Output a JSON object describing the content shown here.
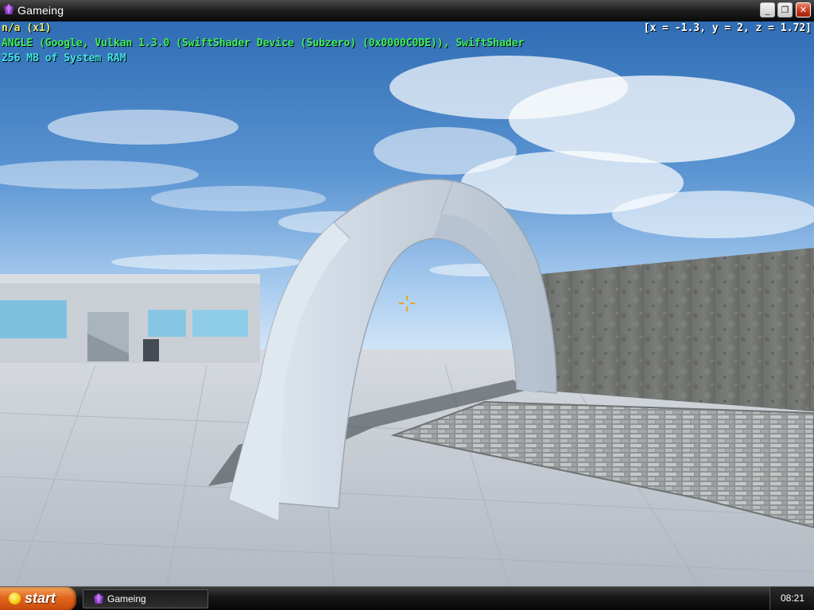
{
  "window": {
    "title": "Gameing",
    "icon": "purple-gem-icon",
    "controls": {
      "minimize": "_",
      "maximize": "❐",
      "close": "✕"
    }
  },
  "hud": {
    "line1": "n/a (x1)",
    "line2": "ANGLE (Google, Vulkan 1.3.0 (SwiftShader Device (Subzero) (0x0000C0DE)), SwiftShader",
    "line3": "256 MB of System RAM",
    "coords": "[x = -1.3, y = 2, z = 1.72]",
    "colors": {
      "line1": "#e8e86a",
      "line2": "#3df05a",
      "line3": "#3fe6e6",
      "coords": "#ffffff"
    }
  },
  "scene": {
    "elements": [
      "sky",
      "ground",
      "stone-arch",
      "concrete-wall",
      "cobblestone-patch",
      "building",
      "crosshair"
    ]
  },
  "taskbar": {
    "start_label": "start",
    "items": [
      {
        "label": "Gameing",
        "icon": "purple-gem-icon"
      }
    ],
    "clock": "08:21"
  }
}
